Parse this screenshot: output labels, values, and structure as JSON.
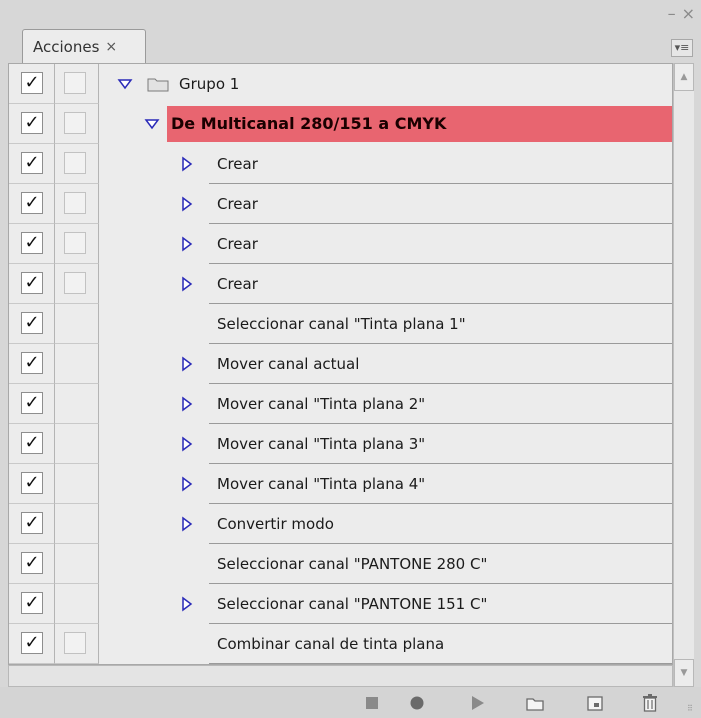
{
  "window": {
    "minimize_label": "–",
    "close_label": "×"
  },
  "tab": {
    "label": "Acciones",
    "close_label": "×",
    "menu_label": "▾≡"
  },
  "rows": [
    {
      "label": "Grupo 1",
      "kind": "group",
      "checked": true,
      "dialog_box": true
    },
    {
      "label": "De Multicanal 280/151 a CMYK",
      "kind": "action",
      "checked": true,
      "dialog_box": true
    },
    {
      "label": "Crear",
      "kind": "step",
      "checked": true,
      "dialog_box": true,
      "expandable": true
    },
    {
      "label": "Crear",
      "kind": "step",
      "checked": true,
      "dialog_box": true,
      "expandable": true
    },
    {
      "label": "Crear",
      "kind": "step",
      "checked": true,
      "dialog_box": true,
      "expandable": true
    },
    {
      "label": "Crear",
      "kind": "step",
      "checked": true,
      "dialog_box": true,
      "expandable": true
    },
    {
      "label": "Seleccionar canal \"Tinta plana 1\"",
      "kind": "step",
      "checked": true,
      "dialog_box": false,
      "expandable": false
    },
    {
      "label": "Mover canal actual",
      "kind": "step",
      "checked": true,
      "dialog_box": false,
      "expandable": true
    },
    {
      "label": "Mover canal \"Tinta plana 2\"",
      "kind": "step",
      "checked": true,
      "dialog_box": false,
      "expandable": true
    },
    {
      "label": "Mover canal \"Tinta plana 3\"",
      "kind": "step",
      "checked": true,
      "dialog_box": false,
      "expandable": true
    },
    {
      "label": "Mover canal \"Tinta plana 4\"",
      "kind": "step",
      "checked": true,
      "dialog_box": false,
      "expandable": true
    },
    {
      "label": "Convertir modo",
      "kind": "step",
      "checked": true,
      "dialog_box": false,
      "expandable": true
    },
    {
      "label": "Seleccionar canal \"PANTONE 280 C\"",
      "kind": "step",
      "checked": true,
      "dialog_box": false,
      "expandable": false
    },
    {
      "label": "Seleccionar canal \"PANTONE 151 C\"",
      "kind": "step",
      "checked": true,
      "dialog_box": false,
      "expandable": true
    },
    {
      "label": "Combinar canal de tinta plana",
      "kind": "step",
      "checked": true,
      "dialog_box": true,
      "expandable": false
    }
  ],
  "colors": {
    "highlight": "#e86570",
    "triangle_fill": "#ffffff",
    "triangle_stroke": "#2a2ab8"
  },
  "toolbar": [
    {
      "icon": "stop-icon"
    },
    {
      "icon": "record-icon"
    },
    {
      "icon": "play-icon"
    },
    {
      "icon": "new-set-folder-icon"
    },
    {
      "icon": "new-action-icon"
    },
    {
      "icon": "trash-icon"
    }
  ]
}
